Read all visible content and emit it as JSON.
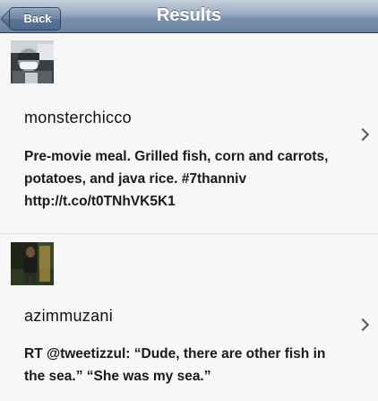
{
  "navbar": {
    "back_label": "Back",
    "title": "Results"
  },
  "results": [
    {
      "username": "monsterchicco",
      "text": "Pre-movie meal. Grilled fish, corn and carrots, potatoes, and java rice. #7thanniv http://t.co/t0TNhVK5K1",
      "avatar_icon": "user-photo-masked-person"
    },
    {
      "username": "azimmuzani",
      "text": "RT @tweetizzul: “Dude, there are other fish in the sea.” “She was my sea.”",
      "avatar_icon": "user-photo-standing-person"
    }
  ],
  "colors": {
    "navbar": "#7d92ae",
    "background": "#f7f7f7",
    "text": "#1a1a1a"
  }
}
